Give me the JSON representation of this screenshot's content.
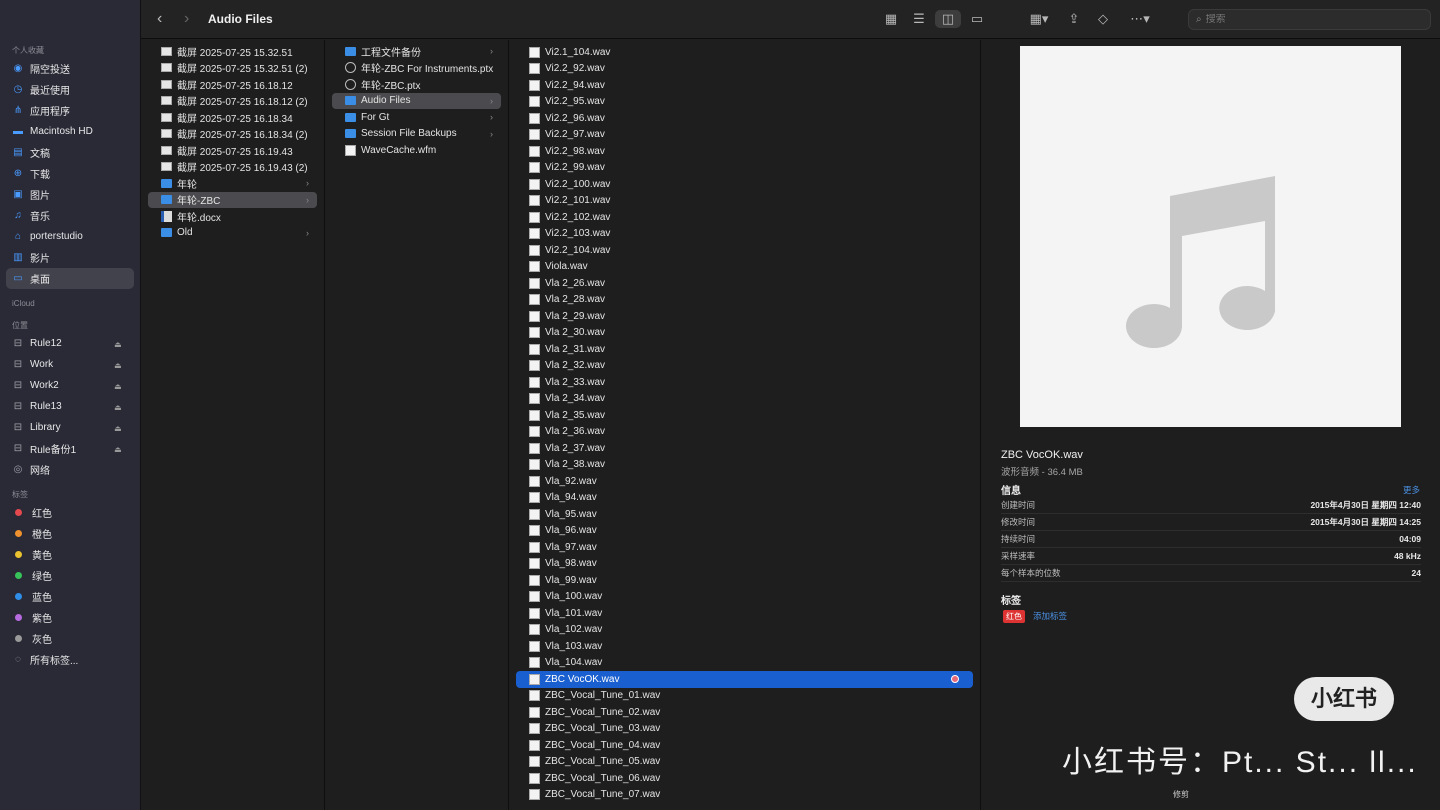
{
  "sidebar": {
    "sections": {
      "favorites": "个人收藏",
      "icloud": "iCloud",
      "locations": "位置",
      "tags": "标签"
    },
    "favorites": [
      {
        "label": "隔空投送",
        "icon": "airdrop-icon"
      },
      {
        "label": "最近使用",
        "icon": "clock-icon"
      },
      {
        "label": "应用程序",
        "icon": "apps-icon"
      },
      {
        "label": "Macintosh HD",
        "icon": "disk-icon"
      },
      {
        "label": "文稿",
        "icon": "document-icon"
      },
      {
        "label": "下载",
        "icon": "download-icon"
      },
      {
        "label": "图片",
        "icon": "photo-icon"
      },
      {
        "label": "音乐",
        "icon": "music-icon"
      },
      {
        "label": "porterstudio",
        "icon": "home-icon"
      },
      {
        "label": "影片",
        "icon": "film-icon"
      },
      {
        "label": "桌面",
        "icon": "desktop-icon"
      }
    ],
    "locations": [
      {
        "label": "Rule12"
      },
      {
        "label": "Work"
      },
      {
        "label": "Work2"
      },
      {
        "label": "Rule13"
      },
      {
        "label": "Library"
      },
      {
        "label": "Rule备份1"
      },
      {
        "label": "网络"
      }
    ],
    "tags": [
      {
        "label": "红色",
        "color": "#e5484d"
      },
      {
        "label": "橙色",
        "color": "#f0912f"
      },
      {
        "label": "黄色",
        "color": "#e8c32f"
      },
      {
        "label": "绿色",
        "color": "#37c35a"
      },
      {
        "label": "蓝色",
        "color": "#2f8fe8"
      },
      {
        "label": "紫色",
        "color": "#b66bdf"
      },
      {
        "label": "灰色",
        "color": "#9a9a9a"
      },
      {
        "label": "所有标签..."
      }
    ]
  },
  "toolbar": {
    "title": "Audio Files",
    "search_placeholder": "搜索"
  },
  "column1": [
    {
      "name": "截屏 2025-07-25 15.32.51",
      "type": "shot"
    },
    {
      "name": "截屏 2025-07-25 15.32.51 (2)",
      "type": "shot"
    },
    {
      "name": "截屏 2025-07-25 16.18.12",
      "type": "shot"
    },
    {
      "name": "截屏 2025-07-25 16.18.12 (2)",
      "type": "shot"
    },
    {
      "name": "截屏 2025-07-25 16.18.34",
      "type": "shot"
    },
    {
      "name": "截屏 2025-07-25 16.18.34 (2)",
      "type": "shot"
    },
    {
      "name": "截屏 2025-07-25 16.19.43",
      "type": "shot"
    },
    {
      "name": "截屏 2025-07-25 16.19.43 (2)",
      "type": "shot"
    },
    {
      "name": "年轮",
      "type": "folder"
    },
    {
      "name": "年轮-ZBC",
      "type": "folder"
    },
    {
      "name": "年轮.docx",
      "type": "word"
    },
    {
      "name": "Old",
      "type": "folder"
    }
  ],
  "column2": [
    {
      "name": "工程文件备份",
      "type": "folder"
    },
    {
      "name": "年轮-ZBC For Instruments.ptx",
      "type": "ptx"
    },
    {
      "name": "年轮-ZBC.ptx",
      "type": "ptx"
    },
    {
      "name": "Audio Files",
      "type": "folder"
    },
    {
      "name": "For Gt",
      "type": "folder"
    },
    {
      "name": "Session File Backups",
      "type": "folder"
    },
    {
      "name": "WaveCache.wfm",
      "type": "doc"
    }
  ],
  "column3": [
    "Vi2.1_104.wav",
    "Vi2.2_92.wav",
    "Vi2.2_94.wav",
    "Vi2.2_95.wav",
    "Vi2.2_96.wav",
    "Vi2.2_97.wav",
    "Vi2.2_98.wav",
    "Vi2.2_99.wav",
    "Vi2.2_100.wav",
    "Vi2.2_101.wav",
    "Vi2.2_102.wav",
    "Vi2.2_103.wav",
    "Vi2.2_104.wav",
    "Viola.wav",
    "Vla 2_26.wav",
    "Vla 2_28.wav",
    "Vla 2_29.wav",
    "Vla 2_30.wav",
    "Vla 2_31.wav",
    "Vla 2_32.wav",
    "Vla 2_33.wav",
    "Vla 2_34.wav",
    "Vla 2_35.wav",
    "Vla 2_36.wav",
    "Vla 2_37.wav",
    "Vla 2_38.wav",
    "Vla_92.wav",
    "Vla_94.wav",
    "Vla_95.wav",
    "Vla_96.wav",
    "Vla_97.wav",
    "Vla_98.wav",
    "Vla_99.wav",
    "Vla_100.wav",
    "Vla_101.wav",
    "Vla_102.wav",
    "Vla_103.wav",
    "Vla_104.wav",
    "ZBC VocOK.wav",
    "ZBC_Vocal_Tune_01.wav",
    "ZBC_Vocal_Tune_02.wav",
    "ZBC_Vocal_Tune_03.wav",
    "ZBC_Vocal_Tune_04.wav",
    "ZBC_Vocal_Tune_05.wav",
    "ZBC_Vocal_Tune_06.wav",
    "ZBC_Vocal_Tune_07.wav"
  ],
  "preview": {
    "name": "ZBC VocOK.wav",
    "kind": "波形音频 - 36.4 MB",
    "info_heading": "信息",
    "more": "更多",
    "info": [
      {
        "k": "创建时间",
        "v": "2015年4月30日 星期四 12:40"
      },
      {
        "k": "修改时间",
        "v": "2015年4月30日 星期四 14:25"
      },
      {
        "k": "持续时间",
        "v": "04:09"
      },
      {
        "k": "采样速率",
        "v": "48 kHz"
      },
      {
        "k": "每个样本的位数",
        "v": "24"
      }
    ],
    "tags_heading": "标签",
    "tag": "红色",
    "add_tag": "添加标签"
  },
  "watermark": {
    "badge": "小红书",
    "text": "小红书号：Pt... St... ll...",
    "cut": "修剪"
  }
}
